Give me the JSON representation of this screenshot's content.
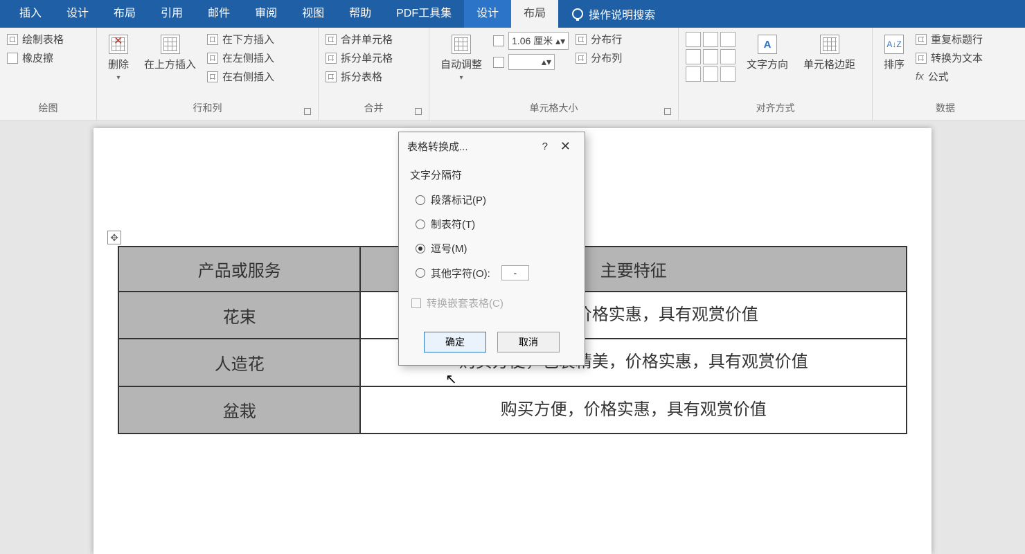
{
  "tabs": [
    "插入",
    "设计",
    "布局",
    "引用",
    "邮件",
    "审阅",
    "视图",
    "帮助",
    "PDF工具集",
    "设计",
    "布局"
  ],
  "tell_me": "操作说明搜索",
  "ribbon": {
    "draw": {
      "draw_table": "绘制表格",
      "eraser": "橡皮擦",
      "label": "绘图"
    },
    "rows_cols": {
      "delete": "删除",
      "insert_above": "在上方插入",
      "insert_below": "在下方插入",
      "insert_left": "在左侧插入",
      "insert_right": "在右侧插入",
      "label": "行和列"
    },
    "merge": {
      "merge_cells": "合并单元格",
      "split_cells": "拆分单元格",
      "split_table": "拆分表格",
      "label": "合并"
    },
    "autofit": {
      "autofit": "自动调整",
      "height_val": "1.06 厘米",
      "dist_rows": "分布行",
      "dist_cols": "分布列",
      "label": "单元格大小"
    },
    "align": {
      "text_dir": "文字方向",
      "cell_margin": "单元格边距",
      "label": "对齐方式"
    },
    "data": {
      "sort": "排序",
      "repeat_header": "重复标题行",
      "convert_text": "转换为文本",
      "formula": "公式",
      "label": "数据"
    }
  },
  "dialog": {
    "title": "表格转换成...",
    "group": "文字分隔符",
    "opt_para": "段落标记(P)",
    "opt_tab": "制表符(T)",
    "opt_comma": "逗号(M)",
    "opt_other": "其他字符(O):",
    "other_val": "-",
    "nested": "转换嵌套表格(C)",
    "ok": "确定",
    "cancel": "取消"
  },
  "table": {
    "head1": "产品或服务",
    "head2": "主要特征",
    "r1_label": "花束",
    "r1_desc_suffix": "装精美，价格实惠，具有观赏价值",
    "r2_label": "人造花",
    "r2_desc": "购买方便，包装精美，价格实惠，具有观赏价值",
    "r3_label": "盆栽",
    "r3_desc": "购买方便，价格实惠，具有观赏价值"
  }
}
